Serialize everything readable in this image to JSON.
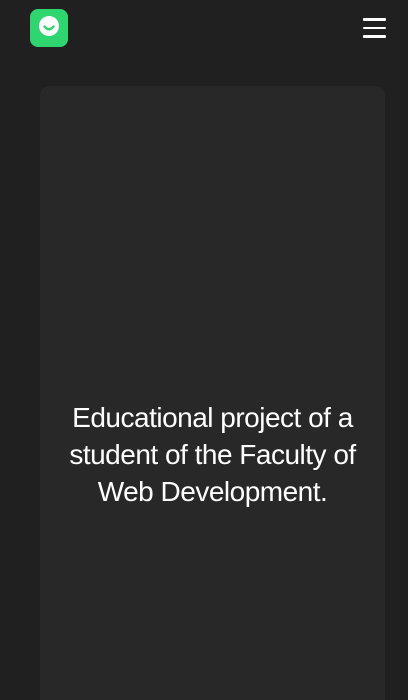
{
  "header": {
    "logo": {
      "icon": "smiley-icon",
      "color": "#2fd670"
    },
    "menu": {
      "icon": "hamburger-menu-icon"
    }
  },
  "main": {
    "card": {
      "text": "Educational project of a student of the Faculty of Web Development."
    }
  },
  "colors": {
    "background": "#202020",
    "card": "#282828",
    "accent": "#2fd670",
    "text": "#ffffff"
  }
}
